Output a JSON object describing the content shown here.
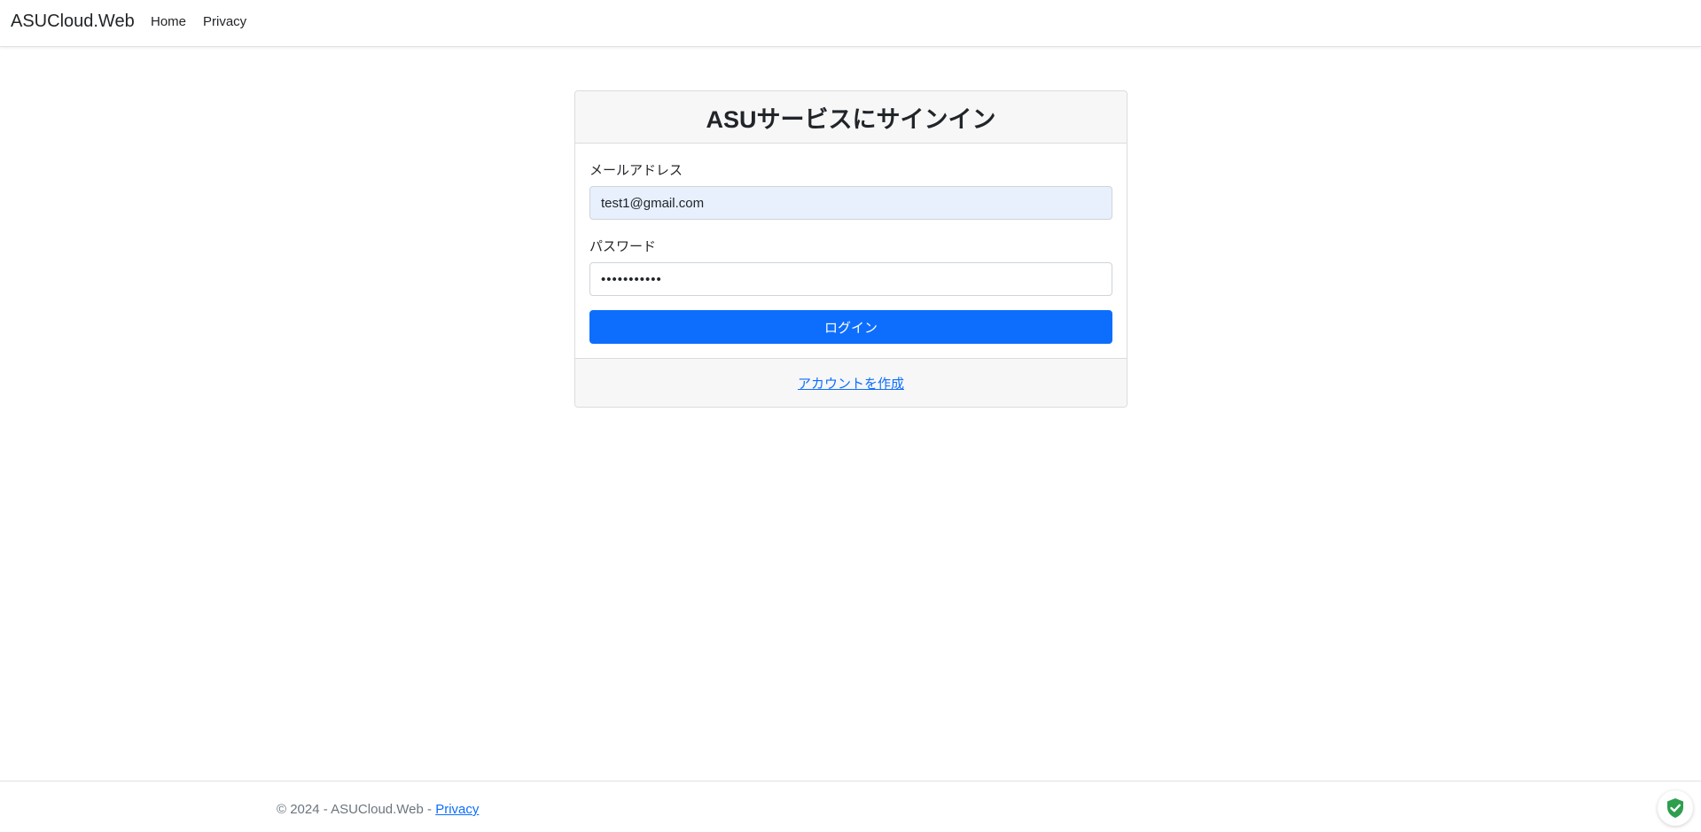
{
  "header": {
    "brand": "ASUCloud.Web",
    "nav": {
      "home": "Home",
      "privacy": "Privacy"
    }
  },
  "login_card": {
    "title": "ASUサービスにサインイン",
    "email_label": "メールアドレス",
    "email_value": "test1@gmail.com",
    "password_label": "パスワード",
    "password_value": "•••••••••••",
    "login_button": "ログイン",
    "create_account_link": "アカウントを作成"
  },
  "footer": {
    "copyright": "© 2024 - ASUCloud.Web - ",
    "privacy_link": "Privacy"
  },
  "colors": {
    "primary": "#0d6efd",
    "autofill_bg": "#e8f0fe",
    "card_header_bg": "#f7f7f7",
    "shield_green": "#2e9e4f"
  },
  "icons": {
    "shield_widget": "shield-check-icon"
  }
}
